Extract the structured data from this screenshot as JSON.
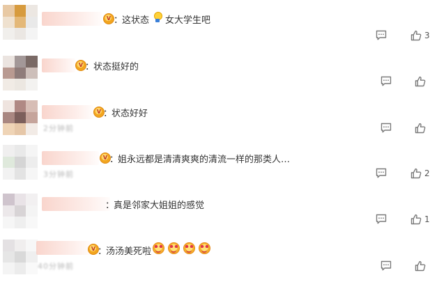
{
  "comments": [
    {
      "colon": "：",
      "text_parts": [
        "这状态",
        "女大学生吧"
      ],
      "emoji_icon": "bulb-icon",
      "reply_icon": "comment-icon",
      "like_icon": "thumbs-up-icon",
      "like_count": "3",
      "meta": ""
    },
    {
      "colon": "：",
      "text": "状态挺好的",
      "reply_icon": "comment-icon",
      "like_icon": "thumbs-up-icon",
      "like_count": "",
      "meta": ""
    },
    {
      "colon": "：",
      "text": "状态好好",
      "reply_icon": "comment-icon",
      "like_icon": "thumbs-up-icon",
      "like_count": "",
      "meta": "2分钟前"
    },
    {
      "colon": "：",
      "text": "姐永远都是清清爽爽的清流一样的那类人…",
      "reply_icon": "comment-icon",
      "like_icon": "thumbs-up-icon",
      "like_count": "2",
      "meta": "3分钟前"
    },
    {
      "colon": "：",
      "text": "真是邻家大姐姐的感觉",
      "reply_icon": "comment-icon",
      "like_icon": "thumbs-up-icon",
      "like_count": "1",
      "meta": ""
    },
    {
      "colon": "：",
      "text": "汤汤美死啦",
      "emojis": [
        "heart-eyes-emoji",
        "heart-eyes-emoji",
        "heart-eyes-emoji",
        "heart-eyes-emoji"
      ],
      "reply_icon": "comment-icon",
      "like_icon": "thumbs-up-icon",
      "like_count": "",
      "meta": "40分钟前"
    }
  ],
  "colors": {
    "text": "#333333",
    "icon": "#7a7a7a",
    "vip_badge": "#f2a51f",
    "name_blur": "#f8cec4"
  }
}
